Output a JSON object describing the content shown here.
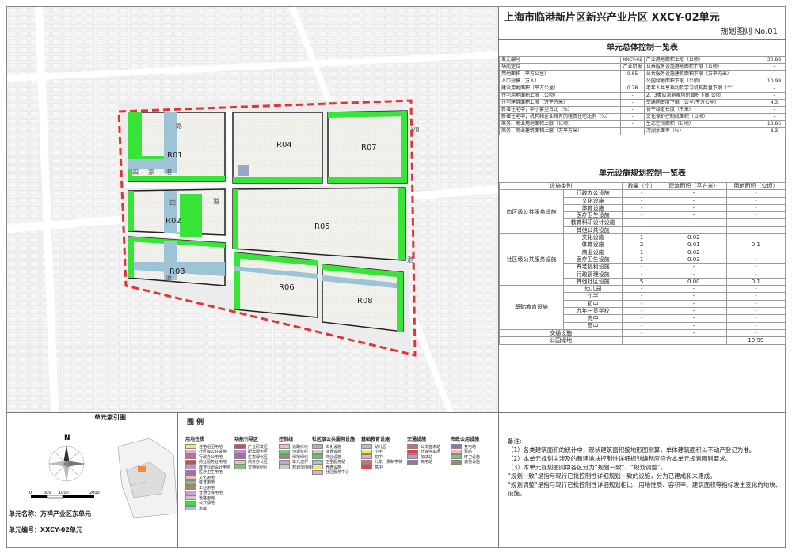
{
  "title": {
    "main": "上海市临港新片区新兴产业片区 XXCY-02单元",
    "sub": "规划图则 No.01"
  },
  "control_table": {
    "heading": "单元总体控制一览表",
    "rows": [
      [
        "单元编号",
        "XXCY-02",
        "产业用地面积上限（公顷）",
        "30.88"
      ],
      [
        "功能定位",
        "产业研发",
        "公共服务设施用地面积下限（公顷）",
        "-"
      ],
      [
        "用地面积（平方公里）",
        "0.85",
        "公共服务设施建筑面积下限（万平方米）",
        "-"
      ],
      [
        "人口规模（万人）",
        "",
        "公园绿地面积下限（公顷）",
        "10.99"
      ],
      [
        "建设用地面积（平方公里）",
        "0.78",
        "老年人共享福利及学习机构数量下限（个）",
        "-"
      ],
      [
        "住宅用地面积上限（公顷）",
        "-",
        "2、3类应急避难场所面积下限(公顷)",
        "-"
      ],
      [
        "住宅建筑面积上限（万平方米）",
        "-",
        "交路网密度下限（公里/平方公里）",
        "4.3"
      ],
      [
        "新增住宅中，中小套型占比（%）",
        "-",
        "骨干绿道长度（千米）",
        "-"
      ],
      [
        "新增住宅中，机构和企业持有的租赁住宅比例（%）",
        "-",
        "文化保护控制线面积（公顷）",
        "-"
      ],
      [
        "商务、商业用地面积上限（公顷）",
        "-",
        "生态空间面积（公顷）",
        "13.86"
      ],
      [
        "商务、商业建筑面积上限（万平方米）",
        "-",
        "河湖水面率（%）",
        "8.3"
      ]
    ]
  },
  "facility_table": {
    "heading": "单元设施规划控制一览表",
    "headers": [
      "设施类别",
      "数量（个）",
      "建筑面积（平方米）",
      "用地面积（公顷）"
    ],
    "groups": [
      {
        "name": "市区级公共服务设施",
        "rows": [
          [
            "行政办公设施",
            "-",
            "-",
            "-"
          ],
          [
            "文化设施",
            "-",
            "-",
            "-"
          ],
          [
            "体育设施",
            "-",
            "-",
            "-"
          ],
          [
            "医疗卫生设施",
            "-",
            "-",
            "-"
          ],
          [
            "教育科研设计设施",
            "-",
            "-",
            "-"
          ],
          [
            "其他公共设施",
            "-",
            "-",
            "-"
          ]
        ]
      },
      {
        "name": "社区级公共服务设施",
        "rows": [
          [
            "文化设施",
            "1",
            "0.02",
            "-"
          ],
          [
            "体育设施",
            "2",
            "0.01",
            "0.1"
          ],
          [
            "商业设施",
            "1",
            "0.02",
            "-"
          ],
          [
            "医疗卫生设施",
            "1",
            "0.03",
            "-"
          ],
          [
            "养老福利设施",
            "-",
            "-",
            "-"
          ],
          [
            "行政管理设施",
            "-",
            "-",
            "-"
          ],
          [
            "其他社区设施",
            "5",
            "0.00",
            "0.1"
          ]
        ]
      },
      {
        "name": "基础教育设施",
        "rows": [
          [
            "幼儿园",
            "-",
            "-",
            "-"
          ],
          [
            "小学",
            "-",
            "-",
            "-"
          ],
          [
            "初中",
            "-",
            "-",
            "-"
          ],
          [
            "九年一贯学校",
            "-",
            "-",
            "-"
          ],
          [
            "完中",
            "-",
            "-",
            "-"
          ],
          [
            "高中",
            "-",
            "-",
            "-"
          ]
        ]
      }
    ],
    "extra_rows": [
      [
        "交通设施",
        "-",
        "-",
        "-"
      ],
      [
        "公园绿地",
        "-",
        "-",
        "10.99"
      ]
    ]
  },
  "map": {
    "parcels": [
      "R01",
      "R02",
      "R03",
      "R04",
      "R05",
      "R06",
      "R07",
      "R08"
    ],
    "road_labels": [
      "路",
      "四",
      "家",
      "港",
      "四",
      "港",
      "港",
      "港"
    ],
    "road_label_side": "V8"
  },
  "index_map": {
    "heading": "单元索引图",
    "north": "N",
    "scale": [
      "0",
      "500",
      "1000",
      "2000"
    ]
  },
  "legend": {
    "heading": "图  例",
    "groups": [
      {
        "title": "用地性质",
        "items": [
          "住宅组团用地",
          "社区级公共设施",
          "行政办公用地",
          "商业服务业用地",
          "教育科研设计用地",
          "医疗卫生用地",
          "文化用地",
          "体育用地",
          "工业用地",
          "普通仓库用地",
          "道路用地",
          "公共绿地",
          "水域"
        ]
      },
      {
        "title": "功能引导区",
        "items": [
          "产业研发区",
          "配套服务区",
          "生态绿化区",
          "商务办公区",
          "交通枢纽区"
        ]
      },
      {
        "title": "控制线",
        "items": [
          "道路红线",
          "河道蓝线",
          "绿地绿线",
          "单元边界",
          "规划范围线"
        ]
      },
      {
        "title": "社区级公共服务设施",
        "items": [
          "文化设施",
          "体育设施",
          "商业设施",
          "卫生服务站",
          "养老设施",
          "社区服务中心"
        ]
      },
      {
        "title": "基础教育设施",
        "items": [
          "幼儿园",
          "小学",
          "初中",
          "九年一贯制学校",
          "高中"
        ]
      },
      {
        "title": "交通设施",
        "items": [
          "公交首末站",
          "社会停车场",
          "加油站",
          "充电站"
        ]
      },
      {
        "title": "市政公用设施",
        "items": [
          "变电站",
          "泵站",
          "环卫设施",
          "通信设施"
        ]
      }
    ]
  },
  "notes": {
    "heading": "备注:",
    "lines": [
      "（1）各类建筑面积的统计中，现状建筑面积按地形图测算，单体建筑面积以不动产登记为准。",
      "（2）本单元规划中涉及的新建地块控制性详细规划编制应符合本单元规划图则要求。",
      "（3）本单元规划图则中各区分为“规划一致”、“规划调整”。",
      "“规划一致”是指与现行已批控制性详细规划一致的设施，分为已建成和未建成。",
      "“规划调整”是指与现行已批控制性详细规划相比，用地性质、容积率、建筑面积等指标发生变化的地块、",
      "设施。"
    ]
  },
  "unit_info": {
    "name": "单元名称：万祥产业区东单元",
    "code": "单元编号：XXCY-02单元"
  }
}
